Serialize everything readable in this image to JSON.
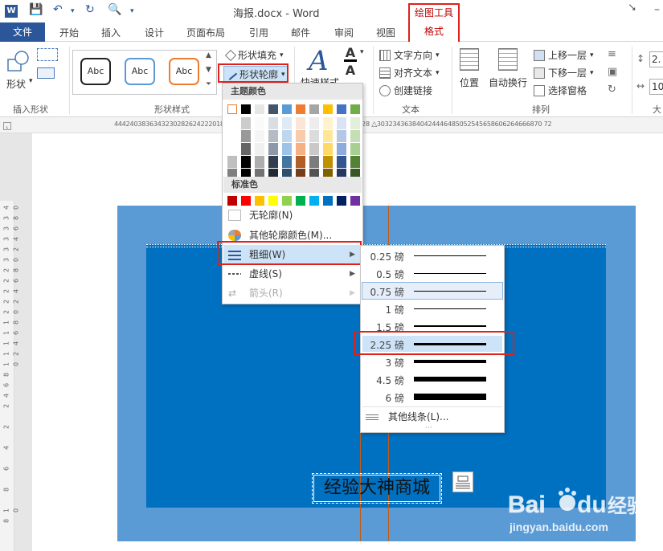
{
  "titlebar": {
    "doc_title": "海报.docx - Word",
    "context_tab_group": "绘图工具"
  },
  "tabs": {
    "file": "文件",
    "items": [
      "开始",
      "插入",
      "设计",
      "页面布局",
      "引用",
      "邮件",
      "审阅",
      "视图"
    ],
    "format": "格式"
  },
  "ribbon": {
    "insert_shapes": {
      "shapes_label": "形状",
      "group_label": "插入形状"
    },
    "shape_styles": {
      "samples": [
        "Abc",
        "Abc",
        "Abc"
      ],
      "fill_label": "形状填充",
      "outline_label": "形状轮廓",
      "group_label": "形状样式"
    },
    "wordart": {
      "quick_styles_label": "快速样式"
    },
    "text": {
      "direction_label": "文字方向",
      "align_label": "对齐文本",
      "link_label": "创建链接",
      "group_label": "文本"
    },
    "arrange": {
      "position_label": "位置",
      "wrap_label": "自动换行",
      "forward_label": "上移一层",
      "backward_label": "下移一层",
      "pane_label": "选择窗格",
      "group_label": "排列"
    },
    "size": {
      "height_prefix": "2.",
      "width_prefix": "10",
      "group_label": "大"
    }
  },
  "ruler": {
    "horizontal_left": "44424038363432302826242220181614121086420246810121416182022242628",
    "horizontal_right": "303234363840424446485052545658606264666870 72",
    "vertical": [
      "40",
      "38",
      "36",
      "34",
      "32",
      "30",
      "28",
      "26",
      "24",
      "22",
      "20",
      "18",
      "16",
      "14",
      "12",
      "10",
      "8",
      "6",
      "4",
      "2",
      "",
      "2",
      "",
      "4",
      "",
      "6",
      "",
      "8",
      "",
      "10",
      "8"
    ]
  },
  "document": {
    "caption": "经验大神商城"
  },
  "outline_menu": {
    "theme_colors_label": "主题颜色",
    "standard_colors_label": "标准色",
    "no_outline": "无轮廓(N)",
    "more_colors": "其他轮廓颜色(M)...",
    "weight": "粗细(W)",
    "dashes": "虚线(S)",
    "arrows": "箭头(R)",
    "theme_colors": [
      "#ffffff",
      "#000000",
      "#e7e6e6",
      "#44546a",
      "#5b9bd5",
      "#ed7d31",
      "#a5a5a5",
      "#ffc000",
      "#4472c4",
      "#70ad47"
    ],
    "standard_colors": [
      "#c00000",
      "#ff0000",
      "#ffc000",
      "#ffff00",
      "#92d050",
      "#00b050",
      "#00b0f0",
      "#0070c0",
      "#002060",
      "#7030a0"
    ]
  },
  "weight_menu": {
    "items": [
      {
        "label": "0.25 磅",
        "pt": 0.25
      },
      {
        "label": "0.5 磅",
        "pt": 0.5
      },
      {
        "label": "0.75 磅",
        "pt": 0.75
      },
      {
        "label": "1 磅",
        "pt": 1
      },
      {
        "label": "1.5 磅",
        "pt": 1.5
      },
      {
        "label": "2.25 磅",
        "pt": 2.25
      },
      {
        "label": "3 磅",
        "pt": 3
      },
      {
        "label": "4.5 磅",
        "pt": 4.5
      },
      {
        "label": "6 磅",
        "pt": 6
      }
    ],
    "selected": "2.25 磅",
    "more_lines": "其他线条(L)..."
  },
  "watermark": {
    "brand": "Bai du 经验",
    "url": "jingyan.baidu.com"
  },
  "colors": {
    "accent": "#2b579a",
    "highlight_red": "#e0201b",
    "poster_outer": "#5b9bd5",
    "poster_inner": "#0070c0"
  }
}
